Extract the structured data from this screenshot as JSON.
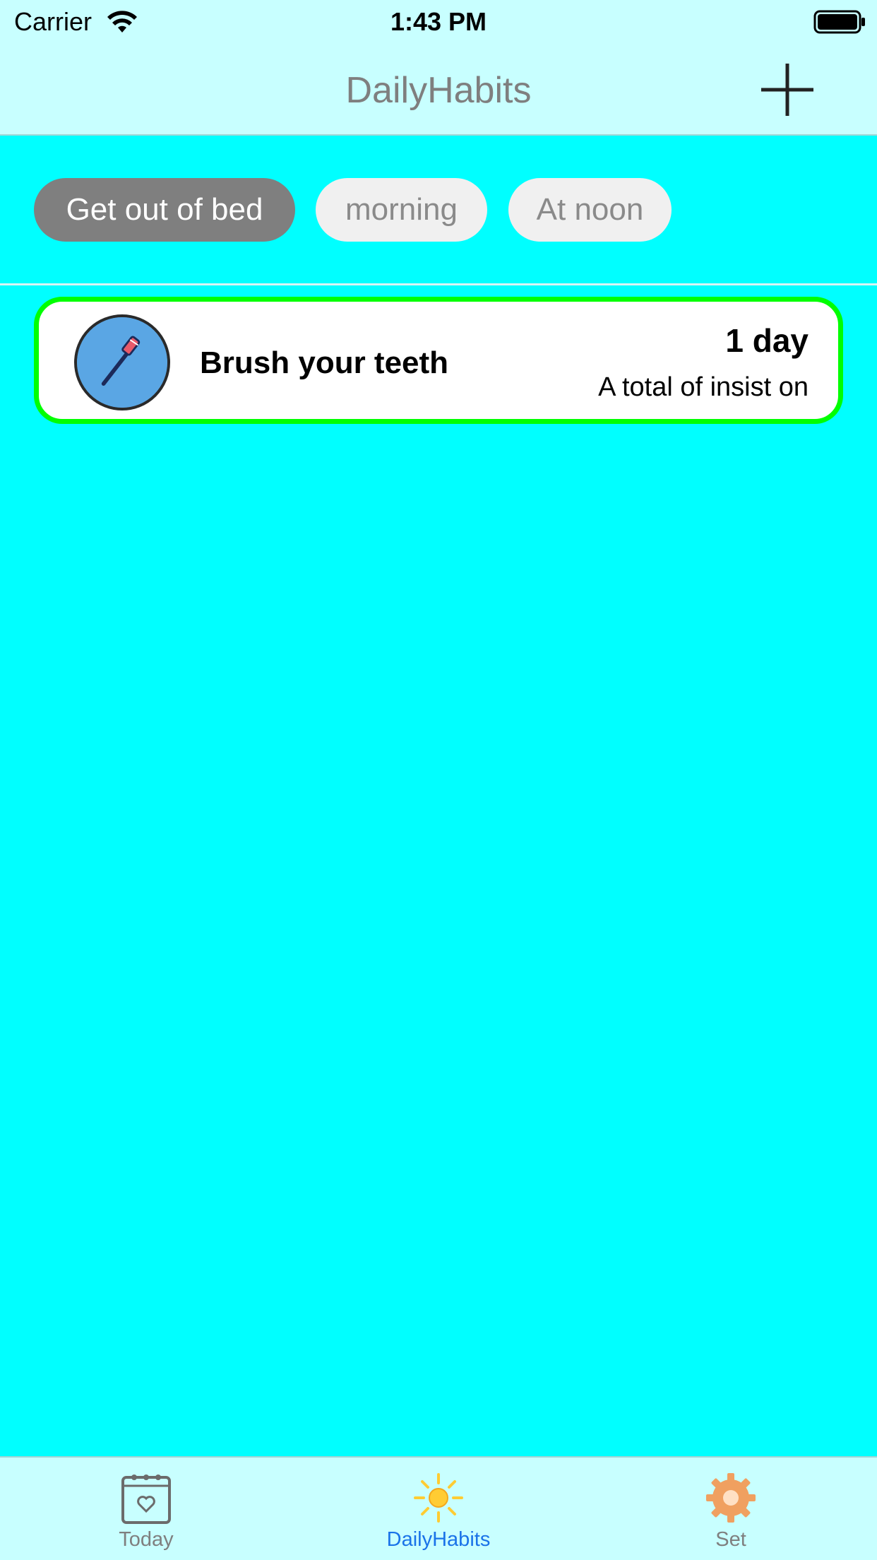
{
  "status_bar": {
    "carrier": "Carrier",
    "time": "1:43 PM",
    "icons": [
      "wifi-icon",
      "battery-icon"
    ]
  },
  "nav": {
    "title": "DailyHabits",
    "add_icon": "plus-icon"
  },
  "filters": {
    "chips": [
      {
        "label": "Get out of bed",
        "active": true
      },
      {
        "label": "morning",
        "active": false
      },
      {
        "label": "At noon",
        "active": false
      }
    ]
  },
  "habits": [
    {
      "name": "Brush your teeth",
      "days": "1 day",
      "caption": "A total of insist on",
      "icon": "toothbrush-icon",
      "border_color": "#00ff00",
      "icon_bg": "#5aa6e4"
    }
  ],
  "tab_bar": {
    "tabs": [
      {
        "label": "Today",
        "icon": "calendar-heart-icon",
        "selected": false
      },
      {
        "label": "DailyHabits",
        "icon": "sun-icon",
        "selected": true
      },
      {
        "label": "Set",
        "icon": "gear-icon",
        "selected": false
      }
    ]
  },
  "colors": {
    "background": "#00ffff",
    "bars": "#c8ffff",
    "accent": "#1a73e8",
    "chip_active": "#7f7f7f"
  }
}
